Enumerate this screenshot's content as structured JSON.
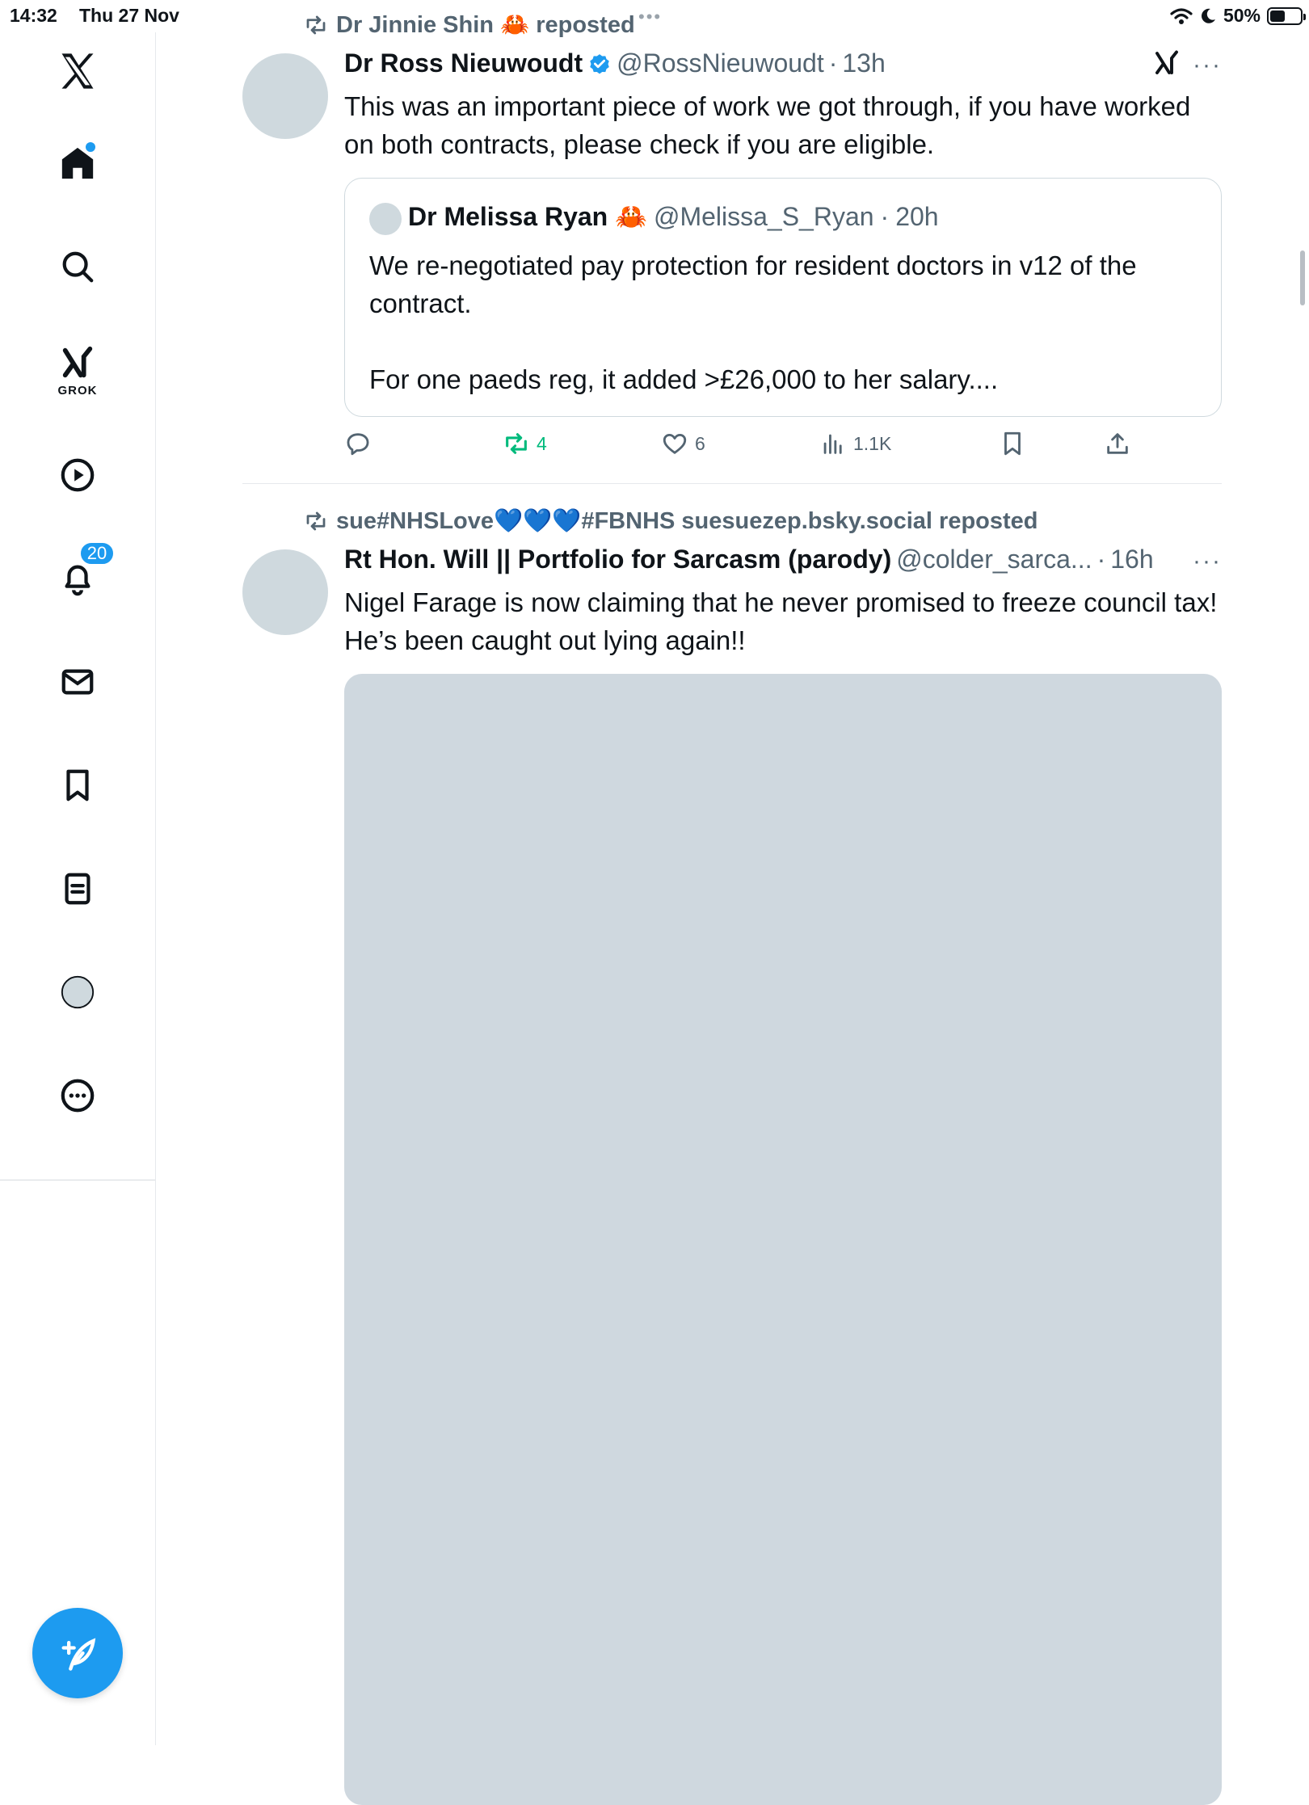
{
  "status_bar": {
    "time": "14:32",
    "date": "Thu 27 Nov",
    "battery": "50%",
    "battery_level": 0.5
  },
  "sidebar": {
    "items": [
      {
        "icon": "x-logo-icon"
      },
      {
        "icon": "home-icon",
        "has_dot": true
      },
      {
        "icon": "search-icon"
      },
      {
        "icon": "grok-icon",
        "label": "GROK"
      },
      {
        "icon": "video-play-icon"
      },
      {
        "icon": "notifications-bell-icon",
        "badge": "20"
      },
      {
        "icon": "messages-envelope-icon"
      },
      {
        "icon": "bookmarks-icon"
      },
      {
        "icon": "lists-icon"
      },
      {
        "icon": "profile-avatar-icon"
      },
      {
        "icon": "more-circle-icon"
      }
    ],
    "compose_icon": "compose-feather-icon"
  },
  "tweets": [
    {
      "repost_by": "Dr Jinnie Shin 🦀 reposted",
      "name": "Dr Ross Nieuwoudt",
      "verified": true,
      "handle": "@RossNieuwoudt",
      "time": "13h",
      "text": "This was an important piece of work we got through, if you have worked on both contracts, please check if you are eligible.",
      "quote": {
        "name": "Dr Melissa Ryan 🦀",
        "handle": "@Melissa_S_Ryan",
        "time": "20h",
        "text_line1": "We re-negotiated pay protection for resident doctors in v12 of the contract.",
        "text_line2": "For one paeds reg, it added >£26,000 to her salary...."
      },
      "actions": {
        "replies": "",
        "reposts": "4",
        "likes": "6",
        "views": "1.1K"
      }
    },
    {
      "repost_by": "sue#NHSLove💙💙💙#FBNHS suesuezep.bsky.social reposted",
      "name": "Rt Hon. Will || Portfolio for Sarcasm (parody)",
      "handle": "@colder_sarca...",
      "time": "16h",
      "text": "Nigel Farage is now claiming that he never promised to freeze council tax! He’s been caught out lying again!!"
    }
  ],
  "colors": {
    "accent": "#1d9bf0",
    "repost_green": "#00ba7c",
    "secondary_text": "#536471",
    "placeholder": "#cfd9de"
  }
}
